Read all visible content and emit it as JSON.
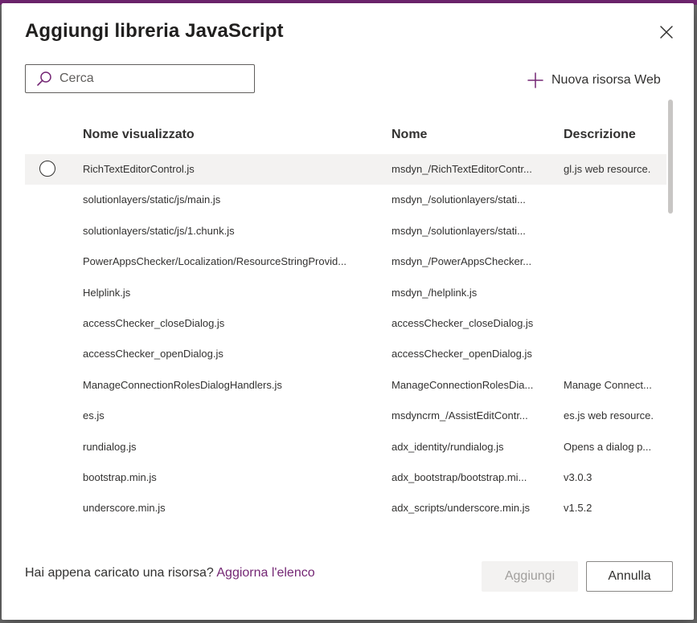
{
  "dialog": {
    "title": "Aggiungi libreria JavaScript",
    "close_label": "Chiudi"
  },
  "search": {
    "placeholder": "Cerca",
    "value": ""
  },
  "new_resource_label": "Nuova risorsa Web",
  "columns": {
    "display_name": "Nome visualizzato",
    "name": "Nome",
    "description": "Descrizione"
  },
  "rows": [
    {
      "display": "RichTextEditorControl.js",
      "name": "msdyn_/RichTextEditorContr...",
      "desc": "gl.js web resource."
    },
    {
      "display": "solutionlayers/static/js/main.js",
      "name": "msdyn_/solutionlayers/stati...",
      "desc": ""
    },
    {
      "display": "solutionlayers/static/js/1.chunk.js",
      "name": "msdyn_/solutionlayers/stati...",
      "desc": ""
    },
    {
      "display": "PowerAppsChecker/Localization/ResourceStringProvid...",
      "name": "msdyn_/PowerAppsChecker...",
      "desc": ""
    },
    {
      "display": "Helplink.js",
      "name": "msdyn_/helplink.js",
      "desc": ""
    },
    {
      "display": "accessChecker_closeDialog.js",
      "name": "accessChecker_closeDialog.js",
      "desc": ""
    },
    {
      "display": "accessChecker_openDialog.js",
      "name": "accessChecker_openDialog.js",
      "desc": ""
    },
    {
      "display": "ManageConnectionRolesDialogHandlers.js",
      "name": "ManageConnectionRolesDia...",
      "desc": "Manage Connect..."
    },
    {
      "display": "es.js",
      "name": "msdyncrm_/AssistEditContr...",
      "desc": "es.js web resource."
    },
    {
      "display": "rundialog.js",
      "name": "adx_identity/rundialog.js",
      "desc": "Opens a dialog p..."
    },
    {
      "display": "bootstrap.min.js",
      "name": "adx_bootstrap/bootstrap.mi...",
      "desc": "v3.0.3"
    },
    {
      "display": "underscore.min.js",
      "name": "adx_scripts/underscore.min.js",
      "desc": "v1.5.2"
    }
  ],
  "footer": {
    "prompt": "Hai appena caricato una risorsa?",
    "refresh_link": "Aggiorna l'elenco",
    "add_button": "Aggiungi",
    "cancel_button": "Annulla"
  },
  "colors": {
    "accent": "#742774",
    "text": "#323130",
    "selected_row": "#f3f2f1",
    "disabled_text": "#a19f9d"
  },
  "icons": {
    "search": "search-icon",
    "add": "plus-icon",
    "close": "close-icon",
    "radio": "radio-icon"
  }
}
